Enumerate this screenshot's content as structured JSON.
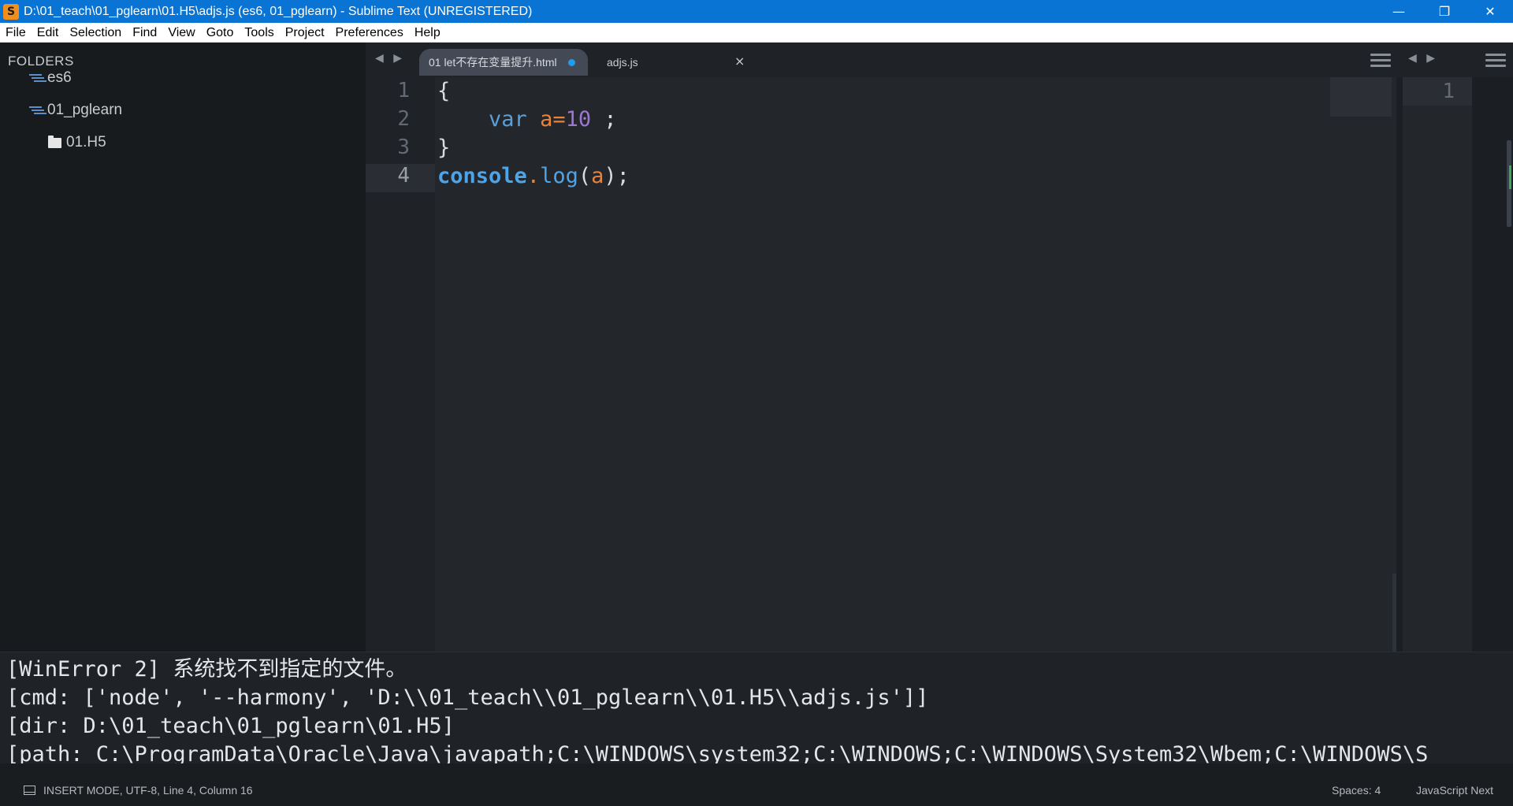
{
  "window": {
    "icon_letter": "S",
    "title": "D:\\01_teach\\01_pglearn\\01.H5\\adjs.js (es6, 01_pglearn) - Sublime Text (UNREGISTERED)",
    "minimize": "—",
    "maximize": "❐",
    "close": "✕"
  },
  "menu": [
    "File",
    "Edit",
    "Selection",
    "Find",
    "View",
    "Goto",
    "Tools",
    "Project",
    "Preferences",
    "Help"
  ],
  "sidebar": {
    "header": "FOLDERS",
    "items": [
      {
        "label": "es6",
        "icon": "folder-open-icon"
      },
      {
        "label": "01_pglearn",
        "icon": "folder-open-icon"
      },
      {
        "label": "01.H5",
        "icon": "folder-icon"
      }
    ]
  },
  "tabs": {
    "nav": "◀ ▶",
    "items": [
      {
        "label": "01 let不存在变量提升.html",
        "active": true,
        "dirty": true
      },
      {
        "label": "adjs.js",
        "active": false,
        "close": "×"
      }
    ],
    "right_nav": "◀ ▶"
  },
  "editor": {
    "line_numbers": [
      "1",
      "2",
      "3",
      "4"
    ],
    "lines": {
      "l1": "{",
      "l2_indent": "    ",
      "l2_kw": "var",
      "l2_var": "a",
      "l2_eq": "=",
      "l2_num": "10",
      "l2_end": " ;",
      "l3": "}",
      "l4_obj": "console",
      "l4_dot": ".",
      "l4_fn": "log",
      "l4_open": "(",
      "l4_arg": "a",
      "l4_close": ");"
    }
  },
  "right_pane": {
    "line_number": "1"
  },
  "output": {
    "lines": [
      "[WinError 2] 系统找不到指定的文件。",
      "[cmd: ['node', '--harmony', 'D:\\\\01_teach\\\\01_pglearn\\\\01.H5\\\\adjs.js']]",
      "[dir: D:\\01_teach\\01_pglearn\\01.H5]",
      "[path: C:\\ProgramData\\Oracle\\Java\\javapath;C:\\WINDOWS\\system32;C:\\WINDOWS;C:\\WINDOWS\\System32\\Wbem;C:\\WINDOWS\\S"
    ]
  },
  "status": {
    "left": "INSERT MODE, UTF-8, Line 4, Column 16",
    "spaces": "Spaces: 4",
    "syntax": "JavaScript Next"
  },
  "colors": {
    "titlebar": "#0a74d5",
    "sidebar_bg": "#181b1e",
    "editor_bg": "#23262b",
    "keyword": "#5a9fd8",
    "variable": "#e8833a",
    "number": "#9b77cf",
    "dirty_dot": "#1e9df0"
  }
}
